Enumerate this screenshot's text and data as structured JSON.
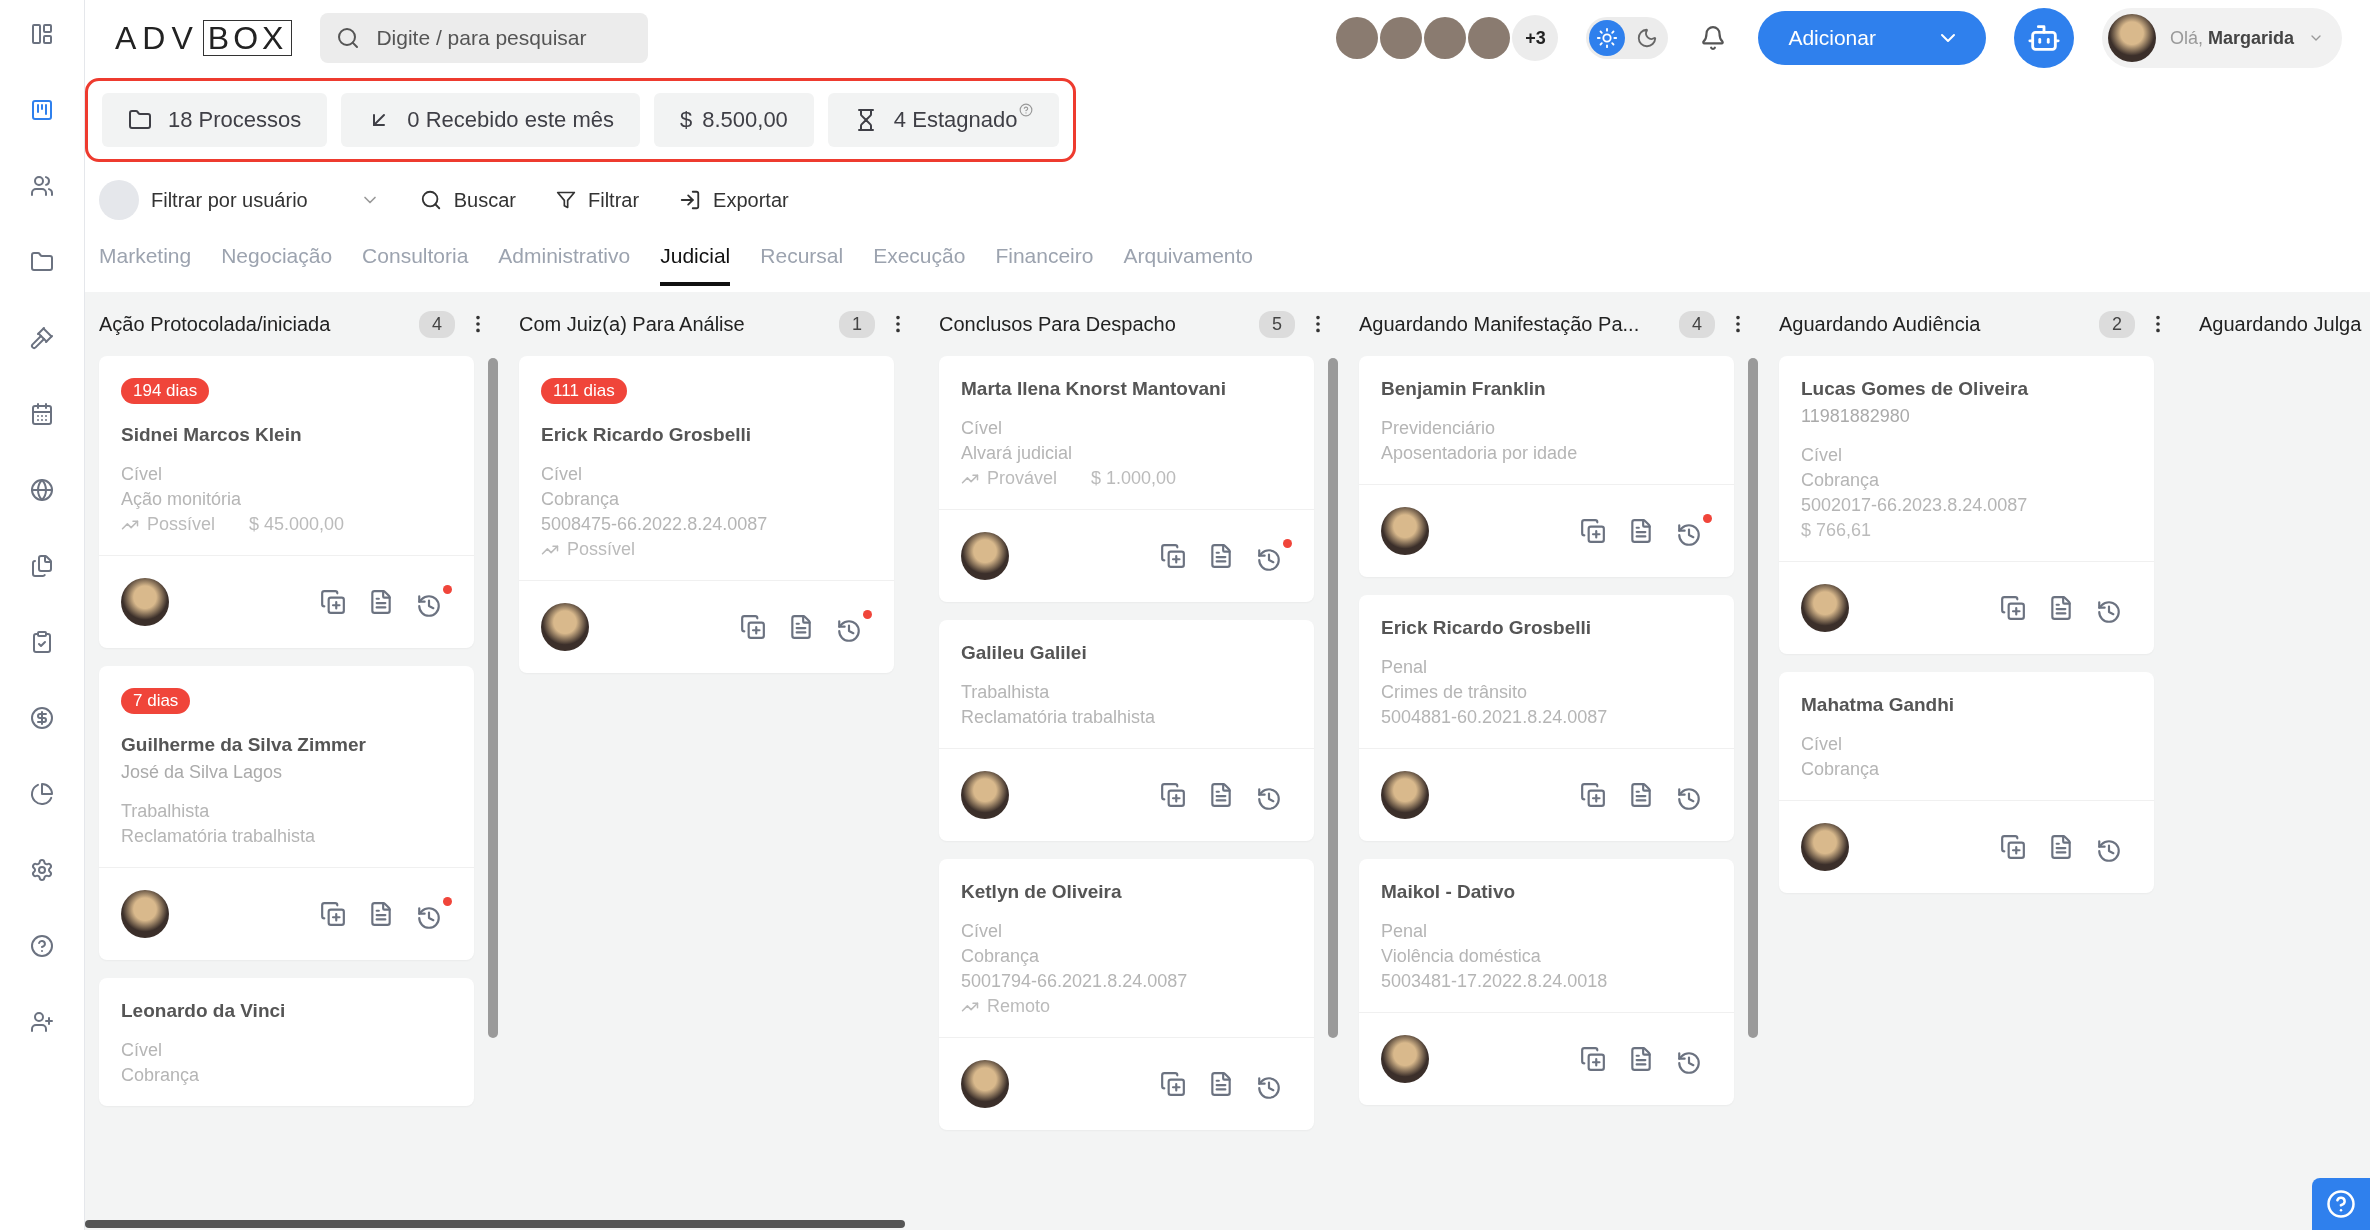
{
  "sidebar": {
    "items": [
      {
        "selected": false
      },
      {
        "selected": true
      },
      {
        "selected": false
      },
      {
        "selected": false
      },
      {
        "selected": false
      },
      {
        "selected": false
      },
      {
        "selected": false
      },
      {
        "selected": false
      },
      {
        "selected": false
      },
      {
        "selected": false
      },
      {
        "selected": false
      },
      {
        "selected": false
      },
      {
        "selected": false
      },
      {
        "selected": false
      }
    ]
  },
  "header": {
    "logo": {
      "left": "ADV",
      "boxed": "BOX"
    },
    "search": {
      "placeholder": "Digite / para pesquisar"
    },
    "team_more": "+3",
    "theme": {
      "light_selected": true
    },
    "add_button": "Adicionar",
    "user_greeting": "Olá, **Margarida**"
  },
  "stats": [
    {
      "kind": "folder",
      "label": "18 Processos"
    },
    {
      "kind": "received",
      "label": "0 Recebido este mês"
    },
    {
      "kind": "money",
      "symbol": "$",
      "label": "8.500,00"
    },
    {
      "kind": "stagnant",
      "label": "4 Estagnado"
    }
  ],
  "filters": {
    "user_filter": "Filtrar por usuário",
    "search": "Buscar",
    "filter": "Filtrar",
    "export": "Exportar"
  },
  "tabs": [
    {
      "label": "Marketing",
      "selected": false
    },
    {
      "label": "Negociação",
      "selected": false
    },
    {
      "label": "Consultoria",
      "selected": false
    },
    {
      "label": "Administrativo",
      "selected": false
    },
    {
      "label": "Judicial",
      "selected": true
    },
    {
      "label": "Recursal",
      "selected": false
    },
    {
      "label": "Execução",
      "selected": false
    },
    {
      "label": "Financeiro",
      "selected": false
    },
    {
      "label": "Arquivamento",
      "selected": false
    }
  ],
  "columns": [
    {
      "title": "Ação Protocolada/iniciada",
      "count": "4",
      "scrollable": true,
      "cards": [
        {
          "badge": "194 dias",
          "title": "Sidnei Marcos Klein",
          "lines": [
            "Cível",
            "Ação monitória"
          ],
          "chance": "Possível",
          "value": "$ 45.000,00",
          "alert": true
        },
        {
          "badge": "7 dias",
          "title": "Guilherme da Silva Zimmer",
          "subtitle": "José da Silva Lagos",
          "lines": [
            "Trabalhista",
            "Reclamatória trabalhista"
          ],
          "alert": true
        },
        {
          "title": "Leonardo da Vinci",
          "lines": [
            "Cível",
            "Cobrança"
          ]
        }
      ]
    },
    {
      "title": "Com Juiz(a) Para Análise",
      "count": "1",
      "scrollable": false,
      "cards": [
        {
          "badge": "111 dias",
          "title": "Erick Ricardo Grosbelli",
          "lines": [
            "Cível",
            "Cobrança"
          ],
          "process": "5008475-66.2022.8.24.0087",
          "chance": "Possível",
          "alert": true
        }
      ]
    },
    {
      "title": "Conclusos Para Despacho",
      "count": "5",
      "scrollable": true,
      "cards": [
        {
          "title": "Marta Ilena Knorst Mantovani",
          "lines": [
            "Cível",
            "Alvará judicial"
          ],
          "chance": "Provável",
          "value": "$ 1.000,00",
          "alert": true
        },
        {
          "title": "Galileu Galilei",
          "lines": [
            "Trabalhista",
            "Reclamatória trabalhista"
          ],
          "alert": false
        },
        {
          "title": "Ketlyn de Oliveira",
          "lines": [
            "Cível",
            "Cobrança"
          ],
          "process": "5001794-66.2021.8.24.0087",
          "chance": "Remoto",
          "alert": false
        }
      ]
    },
    {
      "title": "Aguardando Manifestação Pa...",
      "count": "4",
      "scrollable": true,
      "cards": [
        {
          "title": "Benjamin Franklin",
          "lines": [
            "Previdenciário",
            "Aposentadoria por idade"
          ],
          "alert": true
        },
        {
          "title": "Erick Ricardo Grosbelli",
          "lines": [
            "Penal",
            "Crimes de trânsito"
          ],
          "process": "5004881-60.2021.8.24.0087",
          "alert": false
        },
        {
          "title": "Maikol - Dativo",
          "lines": [
            "Penal",
            "Violência doméstica"
          ],
          "process": "5003481-17.2022.8.24.0018",
          "alert": false
        }
      ]
    },
    {
      "title": "Aguardando Audiência",
      "count": "2",
      "scrollable": false,
      "cards": [
        {
          "title": "Lucas Gomes de Oliveira",
          "subtitle": "11981882980",
          "lines": [
            "Cível",
            "Cobrança"
          ],
          "process": "5002017-66.2023.8.24.0087",
          "value": "$ 766,61",
          "alert": false
        },
        {
          "title": "Mahatma Gandhi",
          "lines": [
            "Cível",
            "Cobrança"
          ],
          "alert": false
        }
      ]
    },
    {
      "title": "Aguardando Julga"
    }
  ]
}
